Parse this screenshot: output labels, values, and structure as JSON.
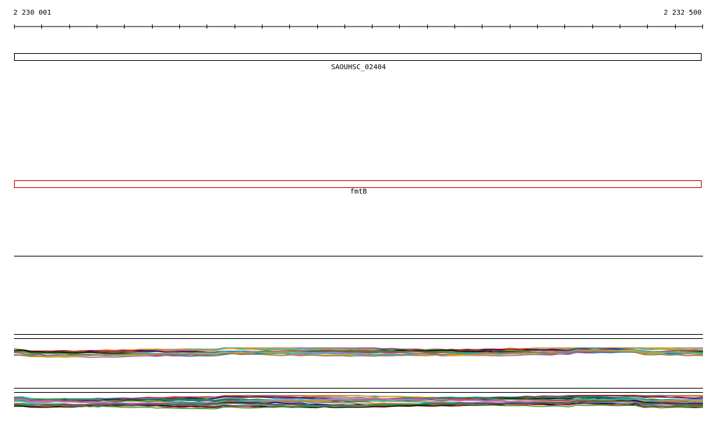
{
  "axis": {
    "start_label": "2 230 001",
    "end_label": "2 232 500",
    "tick_count": 26
  },
  "genes": [
    {
      "name": "SAOUHSC_02404",
      "color": "#000000"
    },
    {
      "name": "fmtB",
      "color": "#cc0000"
    }
  ],
  "track_palette": [
    "#1f77b4",
    "#d62728",
    "#2ca02c",
    "#8c564b",
    "#9467bd",
    "#e377c2",
    "#bcbd22",
    "#17becf",
    "#ff7f0e",
    "#7f7f7f",
    "#000080",
    "#b22222",
    "#228b22",
    "#a0522d",
    "#000000"
  ]
}
